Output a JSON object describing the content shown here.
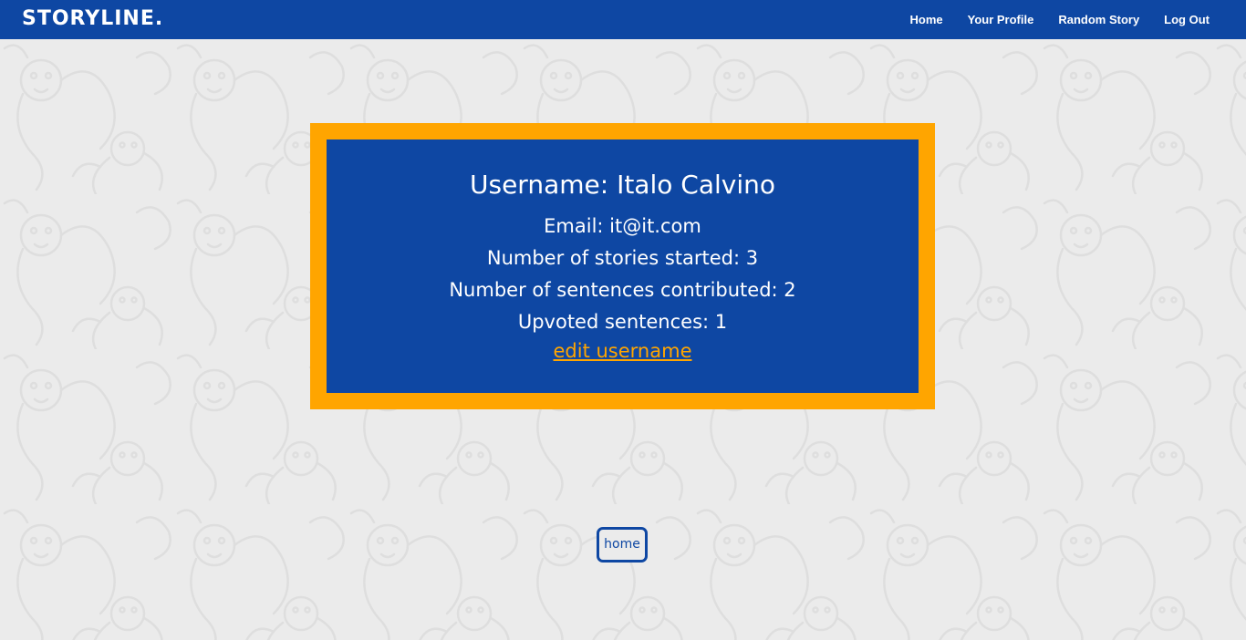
{
  "navbar": {
    "brand": "STORYLINE.",
    "links": [
      "Home",
      "Your Profile",
      "Random Story",
      "Log Out"
    ]
  },
  "profile": {
    "username_label": "Username: Italo Calvino",
    "email_label": "Email: it@it.com",
    "stories_started_label": "Number of stories started:  3",
    "sentences_contributed_label": "Number of sentences contributed:  2",
    "upvoted_sentences_label": "Upvoted sentences:  1",
    "edit_link": "edit username"
  },
  "home_button": "home",
  "colors": {
    "primary": "#0e47a3",
    "accent": "#ffa500",
    "background": "#ebebeb",
    "text_light": "#ffffff"
  }
}
